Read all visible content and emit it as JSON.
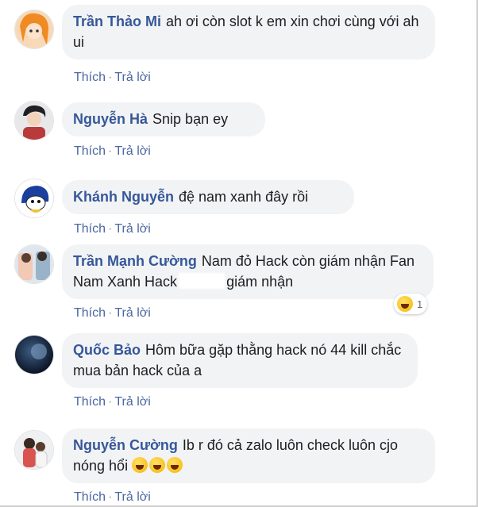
{
  "actions": {
    "like": "Thích",
    "separator": "·",
    "reply": "Trả lời"
  },
  "comments": [
    {
      "name": "Trần Thảo Mi",
      "text": "ah ơi còn slot k em xin chơi cùng với ah ui"
    },
    {
      "name": "Nguyễn Hà",
      "text": "Snip bạn ey"
    },
    {
      "name": "Khánh Nguyễn",
      "text": "đệ nam xanh đây rồi"
    },
    {
      "name": "Trần Mạnh Cường",
      "text_a": "Nam đỏ Hack còn giám nhận Fan Nam Xanh Hack",
      "text_b": "giám nhận",
      "reaction_count": "1",
      "reaction_icon": "haha-reaction-icon"
    },
    {
      "name": "Quốc Bảo",
      "text": "Hôm bữa gặp thằng hack nó 44 kill chắc mua bản hack của a"
    },
    {
      "name": "Nguyễn Cường",
      "text": "Ib r đó cả zalo luôn check luôn cjo nóng hổi",
      "emoji_icon": "rolling-laughing-emoji"
    }
  ],
  "colors": {
    "name": "#365899",
    "action": "#4b67a1",
    "bubble": "#f2f3f5"
  }
}
